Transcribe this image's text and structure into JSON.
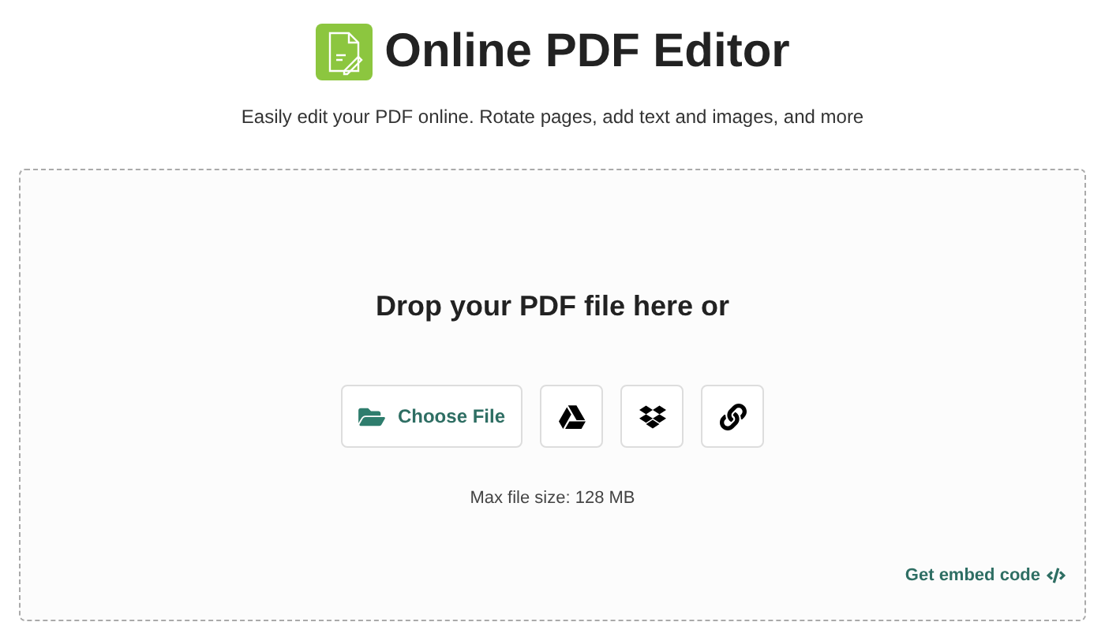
{
  "header": {
    "title": "Online PDF Editor",
    "subtitle": "Easily edit your PDF online. Rotate pages, add text and images, and more"
  },
  "dropzone": {
    "heading": "Drop your PDF file here or",
    "buttons": [
      {
        "kind": "file",
        "label": "Choose File"
      },
      {
        "kind": "drive"
      },
      {
        "kind": "dropbox"
      },
      {
        "kind": "url"
      }
    ],
    "note": "Max file size: 128 MB",
    "embed_link": "Get embed code"
  }
}
